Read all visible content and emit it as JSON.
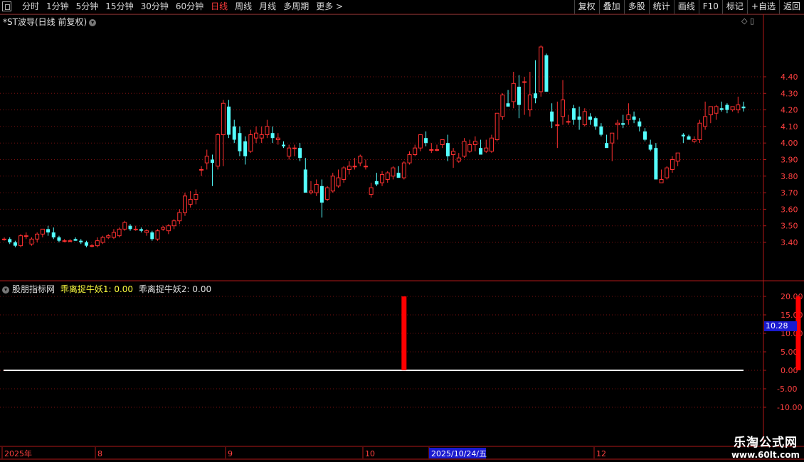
{
  "toolbar": {
    "periods": [
      "分时",
      "1分钟",
      "5分钟",
      "15分钟",
      "30分钟",
      "60分钟",
      "日线",
      "周线",
      "月线",
      "多周期",
      "更多 >"
    ],
    "active_period": "日线",
    "right_buttons": [
      "复权",
      "叠加",
      "多股",
      "统计",
      "画线",
      "F10",
      "标记",
      "+自选",
      "返回"
    ]
  },
  "price_panel": {
    "title": "*ST波导(日线 前复权)",
    "controls": "◇ ▯"
  },
  "indicator_panel": {
    "name": "股朋指标网",
    "line1": "乖离捉牛妖1: 0.00",
    "line2": "乖离捉牛妖2: 0.00",
    "value_tag": "10.28"
  },
  "date_axis": {
    "labels": [
      "2025年",
      "8",
      "9",
      "10",
      "2025/10/24/五",
      "12"
    ]
  },
  "watermark": {
    "line1": "乐淘公式网",
    "line2": "www.60lt.com"
  },
  "colors": {
    "up": "#ff3030",
    "down": "#54ffff",
    "grid": "#7a1010",
    "axis_text": "#ff4040",
    "signal": "#ff0000",
    "baseline": "#ffffff"
  },
  "chart_data": [
    {
      "type": "candlestick",
      "y_ticks": [
        3.4,
        3.5,
        3.6,
        3.7,
        3.8,
        3.9,
        4.0,
        4.1,
        4.2,
        4.3,
        4.4
      ],
      "ylim": [
        3.3,
        4.55
      ],
      "candles": [
        [
          3.42,
          3.43,
          3.41,
          3.42
        ],
        [
          3.42,
          3.43,
          3.39,
          3.4
        ],
        [
          3.4,
          3.41,
          3.37,
          3.38
        ],
        [
          3.38,
          3.45,
          3.37,
          3.44
        ],
        [
          3.44,
          3.46,
          3.42,
          3.44
        ],
        [
          3.39,
          3.43,
          3.38,
          3.42
        ],
        [
          3.42,
          3.46,
          3.4,
          3.45
        ],
        [
          3.45,
          3.48,
          3.43,
          3.48
        ],
        [
          3.48,
          3.5,
          3.44,
          3.46
        ],
        [
          3.46,
          3.49,
          3.42,
          3.43
        ],
        [
          3.43,
          3.44,
          3.4,
          3.41
        ],
        [
          3.41,
          3.42,
          3.4,
          3.41
        ],
        [
          3.41,
          3.42,
          3.4,
          3.41
        ],
        [
          3.42,
          3.43,
          3.41,
          3.41
        ],
        [
          3.41,
          3.42,
          3.39,
          3.4
        ],
        [
          3.4,
          3.41,
          3.37,
          3.38
        ],
        [
          3.38,
          3.39,
          3.37,
          3.38
        ],
        [
          3.38,
          3.43,
          3.37,
          3.41
        ],
        [
          3.4,
          3.44,
          3.39,
          3.43
        ],
        [
          3.43,
          3.45,
          3.42,
          3.44
        ],
        [
          3.43,
          3.48,
          3.42,
          3.46
        ],
        [
          3.44,
          3.49,
          3.43,
          3.48
        ],
        [
          3.48,
          3.53,
          3.47,
          3.52
        ],
        [
          3.5,
          3.51,
          3.47,
          3.48
        ],
        [
          3.48,
          3.5,
          3.47,
          3.48
        ],
        [
          3.48,
          3.49,
          3.46,
          3.47
        ],
        [
          3.46,
          3.48,
          3.44,
          3.47
        ],
        [
          3.46,
          3.47,
          3.41,
          3.42
        ],
        [
          3.42,
          3.48,
          3.41,
          3.47
        ],
        [
          3.48,
          3.5,
          3.47,
          3.49
        ],
        [
          3.47,
          3.51,
          3.45,
          3.5
        ],
        [
          3.5,
          3.54,
          3.48,
          3.53
        ],
        [
          3.53,
          3.6,
          3.51,
          3.58
        ],
        [
          3.58,
          3.7,
          3.56,
          3.68
        ],
        [
          3.63,
          3.71,
          3.61,
          3.66
        ],
        [
          3.66,
          3.72,
          3.63,
          3.69
        ],
        [
          3.84,
          3.86,
          3.8,
          3.84
        ],
        [
          3.88,
          3.96,
          3.84,
          3.92
        ],
        [
          3.9,
          3.93,
          3.74,
          3.88
        ],
        [
          3.86,
          4.06,
          3.84,
          4.05
        ],
        [
          4.05,
          4.26,
          3.86,
          4.24
        ],
        [
          4.22,
          4.26,
          4.03,
          4.05
        ],
        [
          4.1,
          4.14,
          4.0,
          4.02
        ],
        [
          4.06,
          4.1,
          3.92,
          3.95
        ],
        [
          4.01,
          4.04,
          3.87,
          3.92
        ],
        [
          3.95,
          4.08,
          3.94,
          4.05
        ],
        [
          4.03,
          4.1,
          4.0,
          4.06
        ],
        [
          4.03,
          4.1,
          4.0,
          4.05
        ],
        [
          4.05,
          4.14,
          4.03,
          4.1
        ],
        [
          4.06,
          4.1,
          4.0,
          4.03
        ],
        [
          4.02,
          4.06,
          3.99,
          4.03
        ],
        [
          3.99,
          4.01,
          3.97,
          3.98
        ],
        [
          3.92,
          3.99,
          3.9,
          3.97
        ],
        [
          3.97,
          3.99,
          3.92,
          3.97
        ],
        [
          3.97,
          4.0,
          3.89,
          3.91
        ],
        [
          3.84,
          3.91,
          3.74,
          3.7
        ],
        [
          3.7,
          3.77,
          3.69,
          3.71
        ],
        [
          3.7,
          3.78,
          3.68,
          3.75
        ],
        [
          3.74,
          3.78,
          3.55,
          3.64
        ],
        [
          3.66,
          3.74,
          3.65,
          3.73
        ],
        [
          3.71,
          3.82,
          3.7,
          3.8
        ],
        [
          3.74,
          3.84,
          3.73,
          3.79
        ],
        [
          3.78,
          3.86,
          3.76,
          3.85
        ],
        [
          3.84,
          3.89,
          3.81,
          3.86
        ],
        [
          3.86,
          3.91,
          3.84,
          3.86
        ],
        [
          3.88,
          3.93,
          3.86,
          3.92
        ],
        [
          3.86,
          3.9,
          3.84,
          3.86
        ],
        [
          3.69,
          3.76,
          3.67,
          3.73
        ],
        [
          3.77,
          3.82,
          3.74,
          3.75
        ],
        [
          3.76,
          3.83,
          3.74,
          3.81
        ],
        [
          3.78,
          3.83,
          3.76,
          3.82
        ],
        [
          3.8,
          3.86,
          3.78,
          3.85
        ],
        [
          3.82,
          3.86,
          3.79,
          3.79
        ],
        [
          3.79,
          3.89,
          3.78,
          3.88
        ],
        [
          3.88,
          3.95,
          3.87,
          3.93
        ],
        [
          3.93,
          3.99,
          3.92,
          3.97
        ],
        [
          3.97,
          4.05,
          3.95,
          4.05
        ],
        [
          4.03,
          4.07,
          3.98,
          4.0
        ],
        [
          3.96,
          4.0,
          3.94,
          3.96
        ],
        [
          3.96,
          3.99,
          3.95,
          3.96
        ],
        [
          3.99,
          4.02,
          3.97,
          4.02
        ],
        [
          4.0,
          4.05,
          3.89,
          3.92
        ],
        [
          3.93,
          3.97,
          3.85,
          3.95
        ],
        [
          3.89,
          3.94,
          3.88,
          3.91
        ],
        [
          3.92,
          4.03,
          3.91,
          4.01
        ],
        [
          3.95,
          4.02,
          3.94,
          3.99
        ],
        [
          3.99,
          4.04,
          3.95,
          4.01
        ],
        [
          3.97,
          4.02,
          3.94,
          3.93
        ],
        [
          3.95,
          4.02,
          3.94,
          3.97
        ],
        [
          3.95,
          4.05,
          3.94,
          4.03
        ],
        [
          4.02,
          4.15,
          4.01,
          4.18
        ],
        [
          4.16,
          4.3,
          4.14,
          4.29
        ],
        [
          4.24,
          4.32,
          4.22,
          4.22
        ],
        [
          4.25,
          4.43,
          4.21,
          4.36
        ],
        [
          4.34,
          4.41,
          4.15,
          4.23
        ],
        [
          4.37,
          4.4,
          4.17,
          4.37
        ],
        [
          4.2,
          4.43,
          4.16,
          4.29
        ],
        [
          4.3,
          4.5,
          4.24,
          4.27
        ],
        [
          4.31,
          4.59,
          4.28,
          4.58
        ],
        [
          4.53,
          4.54,
          4.32,
          4.31
        ],
        [
          4.19,
          4.24,
          4.09,
          4.13
        ],
        [
          4.11,
          4.25,
          3.97,
          4.11
        ],
        [
          4.16,
          4.38,
          4.11,
          4.26
        ],
        [
          4.13,
          4.17,
          4.11,
          4.13
        ],
        [
          4.21,
          4.23,
          4.11,
          4.14
        ],
        [
          4.16,
          4.22,
          4.08,
          4.14
        ],
        [
          4.11,
          4.21,
          4.1,
          4.19
        ],
        [
          4.16,
          4.18,
          4.11,
          4.14
        ],
        [
          4.15,
          4.16,
          4.08,
          4.1
        ],
        [
          4.1,
          4.12,
          4.04,
          4.05
        ],
        [
          4.0,
          4.05,
          3.98,
          3.97
        ],
        [
          4.0,
          4.05,
          3.89,
          4.06
        ],
        [
          4.11,
          4.14,
          4.02,
          4.12
        ],
        [
          4.12,
          4.17,
          4.09,
          4.11
        ],
        [
          4.14,
          4.24,
          4.11,
          4.17
        ],
        [
          4.16,
          4.19,
          4.12,
          4.14
        ],
        [
          4.13,
          4.15,
          4.07,
          4.1
        ],
        [
          4.07,
          4.09,
          4.01,
          4.02
        ],
        [
          3.99,
          4.02,
          3.95,
          3.96
        ],
        [
          3.97,
          4.0,
          3.92,
          3.78
        ],
        [
          3.76,
          3.84,
          3.77,
          3.78
        ],
        [
          3.79,
          3.86,
          3.78,
          3.85
        ],
        [
          3.84,
          3.92,
          3.82,
          3.9
        ],
        [
          3.89,
          3.94,
          3.86,
          3.94
        ],
        [
          4.05,
          4.06,
          4.0,
          4.04
        ],
        [
          4.04,
          4.05,
          4.02,
          4.02
        ],
        [
          4.01,
          4.04,
          4.0,
          4.02
        ],
        [
          4.02,
          4.14,
          4.0,
          4.12
        ],
        [
          4.1,
          4.25,
          4.08,
          4.16
        ],
        [
          4.17,
          4.22,
          4.12,
          4.22
        ],
        [
          4.18,
          4.23,
          4.14,
          4.22
        ],
        [
          4.21,
          4.25,
          4.19,
          4.2
        ],
        [
          4.23,
          4.24,
          4.18,
          4.2
        ],
        [
          4.2,
          4.22,
          4.19,
          4.22
        ],
        [
          4.2,
          4.28,
          4.18,
          4.23
        ],
        [
          4.22,
          4.25,
          4.19,
          4.21
        ]
      ]
    },
    {
      "type": "bar",
      "series": [
        {
          "name": "乖离捉牛妖1",
          "values": [
            {
              "index": 73,
              "value": 20.0
            },
            {
              "index": 145,
              "value": 20.0
            }
          ]
        },
        {
          "name": "乖离捉牛妖2",
          "values": []
        }
      ],
      "y_ticks": [
        20.0,
        15.0,
        10.0,
        5.0,
        0.0,
        -5.0,
        -10.0
      ],
      "ylim": [
        -12,
        22
      ]
    }
  ]
}
